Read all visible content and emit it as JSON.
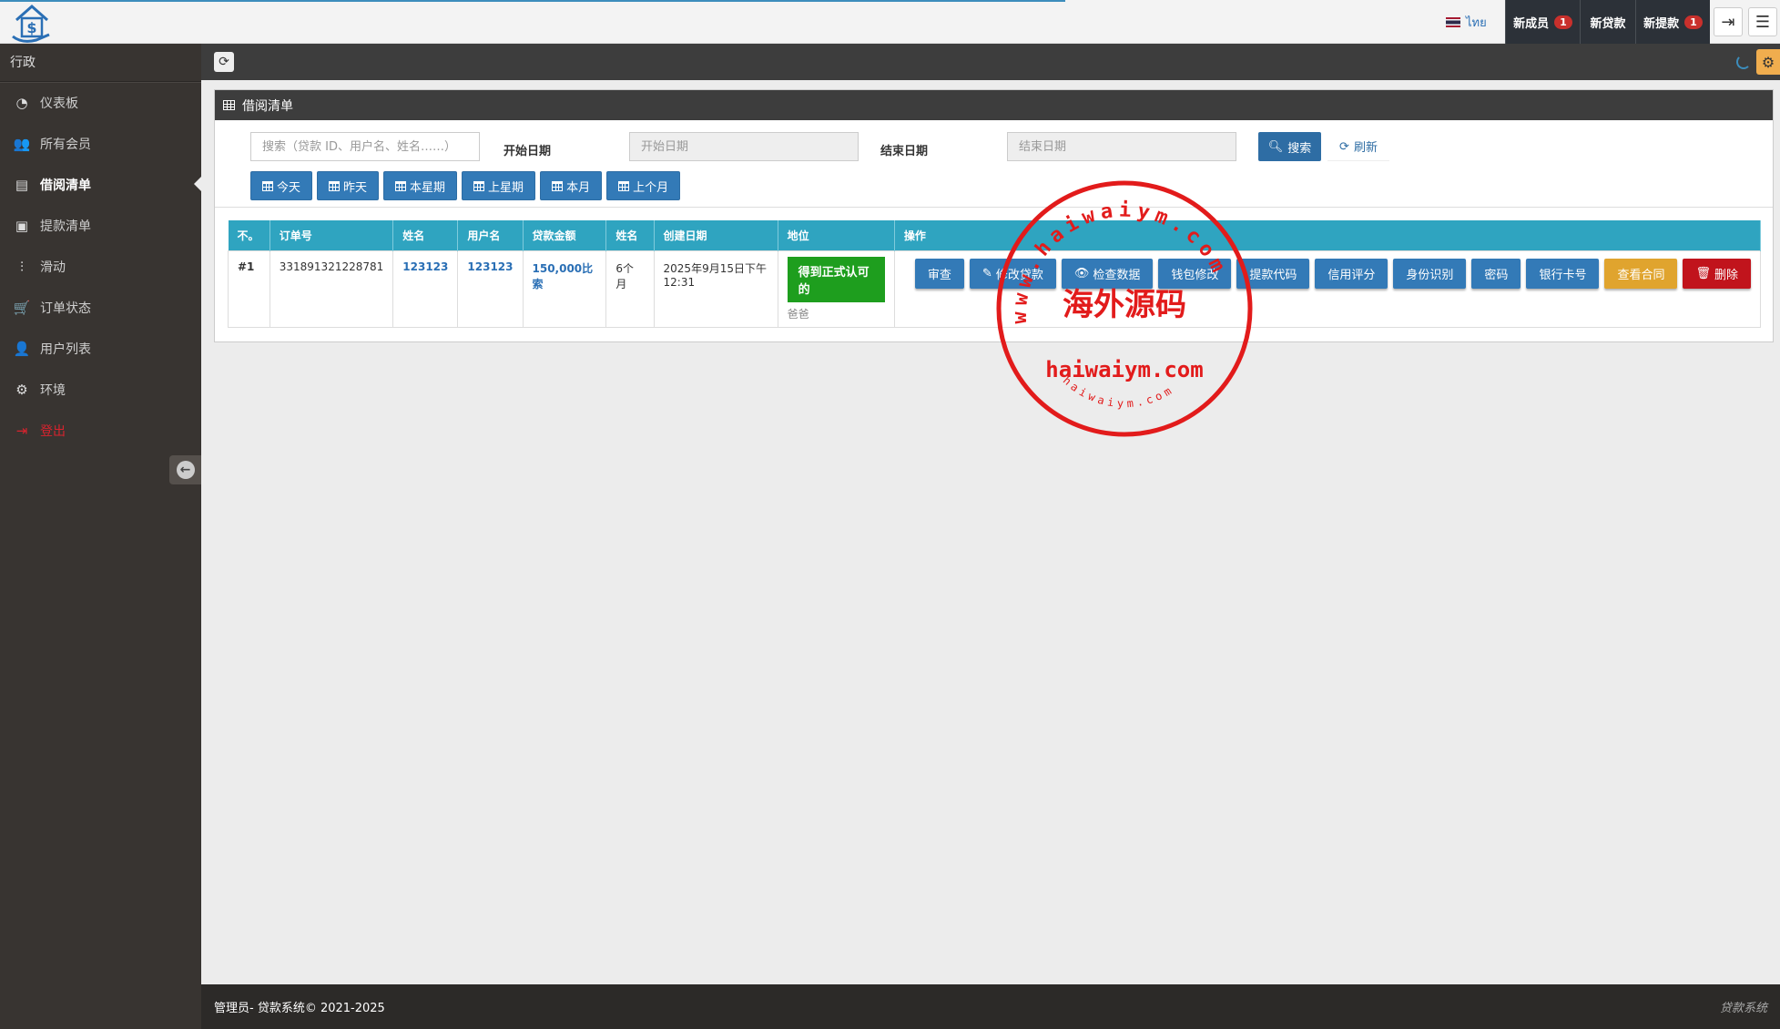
{
  "header": {
    "language": "ไทย",
    "notifications": [
      {
        "label": "新成员",
        "count": "1"
      },
      {
        "label": "新贷款",
        "count": ""
      },
      {
        "label": "新提款",
        "count": "1"
      }
    ]
  },
  "sidebar": {
    "heading": "行政",
    "items": [
      {
        "label": "仪表板",
        "icon": "dashboard-icon"
      },
      {
        "label": "所有会员",
        "icon": "users-icon"
      },
      {
        "label": "借阅清单",
        "icon": "book-icon"
      },
      {
        "label": "提款清单",
        "icon": "money-icon"
      },
      {
        "label": "滑动",
        "icon": "sliders-icon"
      },
      {
        "label": "订单状态",
        "icon": "cart-icon"
      },
      {
        "label": "用户列表",
        "icon": "user-icon"
      },
      {
        "label": "环境",
        "icon": "gear-icon"
      },
      {
        "label": "登出",
        "icon": "logout-icon"
      }
    ]
  },
  "panel": {
    "title": "借阅清单",
    "search_placeholder": "搜索（贷款 ID、用户名、姓名……）",
    "start_label": "开始日期",
    "start_placeholder": "开始日期",
    "end_label": "结束日期",
    "end_placeholder": "结束日期",
    "search_button": "搜索",
    "refresh_button": "刷新",
    "quick_filters": [
      "今天",
      "昨天",
      "本星期",
      "上星期",
      "本月",
      "上个月"
    ]
  },
  "table": {
    "headers": [
      "不。",
      "订单号",
      "姓名",
      "用户名",
      "贷款金额",
      "姓名",
      "创建日期",
      "地位",
      "操作"
    ],
    "rows": [
      {
        "no": "#1",
        "order_id": "331891321228781",
        "name": "123123",
        "username": "123123",
        "amount": "150,000比索",
        "term": "6个月",
        "created": "2025年9月15日下午12:31",
        "status": "得到正式认可的",
        "status_sub": "爸爸"
      }
    ],
    "actions": [
      {
        "label": "审查",
        "style": "primary"
      },
      {
        "label": "修改贷款",
        "style": "primary"
      },
      {
        "label": "检查数据",
        "style": "primary"
      },
      {
        "label": "钱包修改",
        "style": "primary"
      },
      {
        "label": "提款代码",
        "style": "primary"
      },
      {
        "label": "信用评分",
        "style": "primary"
      },
      {
        "label": "身份识别",
        "style": "primary"
      },
      {
        "label": "密码",
        "style": "primary"
      },
      {
        "label": "银行卡号",
        "style": "primary"
      },
      {
        "label": "查看合同",
        "style": "warning"
      },
      {
        "label": "删除",
        "style": "danger"
      }
    ]
  },
  "footer": {
    "left": "管理员- 贷款系统© 2021-2025",
    "right": "贷款系统"
  },
  "watermark": {
    "arc_text": "www.haiwaiym.com",
    "center_text": "海外源码",
    "domain_text": "haiwaiym.com",
    "bottom_text": "haiwaiym.com"
  },
  "colors": {
    "accent": "#337ab7",
    "table_header": "#2fa4c0",
    "sidebar": "#383431",
    "success": "#1e9e1e",
    "warning": "#e0a42e",
    "danger": "#c1141c"
  }
}
